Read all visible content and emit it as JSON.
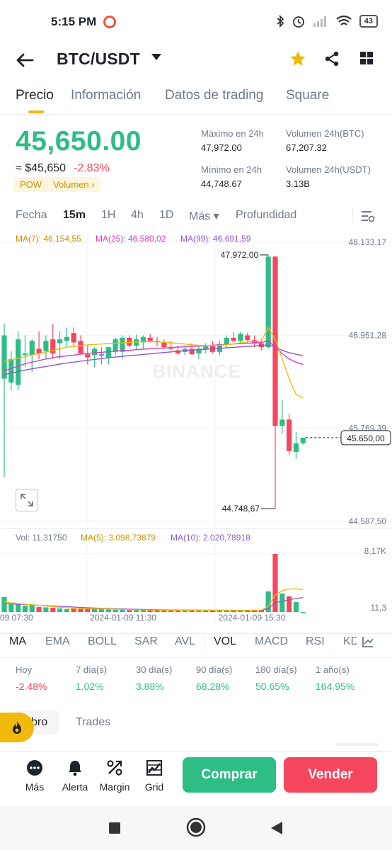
{
  "status_bar": {
    "time": "5:15 PM",
    "battery": "43"
  },
  "header": {
    "pair": "BTC/USDT"
  },
  "tabs": [
    {
      "label": "Precio"
    },
    {
      "label": "Información"
    },
    {
      "label": "Datos de trading"
    },
    {
      "label": "Square"
    }
  ],
  "ticker": {
    "price": "45,650.00",
    "usd_approx": "≈ $45,650",
    "change": "-2.83%",
    "tags": [
      "POW",
      "Volumen"
    ],
    "stats": [
      {
        "label": "Máximo en 24h",
        "value": "47,972.00"
      },
      {
        "label": "Volumen 24h(BTC)",
        "value": "67,207.32"
      },
      {
        "label": "Mínimo en 24h",
        "value": "44,748.67"
      },
      {
        "label": "Volumen 24h(USDT)",
        "value": "3.13B"
      }
    ]
  },
  "timeframes": [
    {
      "label": "Fecha"
    },
    {
      "label": "15m"
    },
    {
      "label": "1H"
    },
    {
      "label": "4h"
    },
    {
      "label": "1D"
    },
    {
      "label": "Más"
    },
    {
      "label": "Profundidad"
    }
  ],
  "ma_legend": {
    "ma7": "MA(7): 46.154,55",
    "ma25": "MA(25): 46.580,02",
    "ma99": "MA(99): 46.691,59"
  },
  "price_axis": [
    "48.133,17",
    "46.951,28",
    "45.769,39",
    "44.587,50"
  ],
  "chart_annotations": {
    "high": "47.972,00",
    "low": "44.748,67",
    "last": "45.650,00",
    "watermark": "BINANCE"
  },
  "volume_legend": {
    "vol": "Vol: 11,31750",
    "ma5": "MA(5): 3.098,73879",
    "ma10": "MA(10): 2.020,78918"
  },
  "volume_axis": [
    "8,17K",
    "11,3"
  ],
  "time_axis": [
    "09 07:30",
    "2024-01-09 11:30",
    "2024-01-09 15:30"
  ],
  "indicators": [
    {
      "label": "MA"
    },
    {
      "label": "EMA"
    },
    {
      "label": "BOLL"
    },
    {
      "label": "SAR"
    },
    {
      "label": "AVL"
    },
    {
      "label": "VOL"
    },
    {
      "label": "MACD"
    },
    {
      "label": "RSI"
    },
    {
      "label": "KD"
    }
  ],
  "performance": [
    {
      "label": "Hoy",
      "value": "-2.48%"
    },
    {
      "label": "7 día(s)",
      "value": "1.02%"
    },
    {
      "label": "30 día(s)",
      "value": "3.88%"
    },
    {
      "label": "90 día(s)",
      "value": "68.28%"
    },
    {
      "label": "180 día(s)",
      "value": "50.65%"
    },
    {
      "label": "1 año(s)",
      "value": "164.95%"
    }
  ],
  "book_tabs": [
    {
      "label": "bro"
    },
    {
      "label": "Trades"
    }
  ],
  "bottom_actions": [
    {
      "label": "Más"
    },
    {
      "label": "Alerta"
    },
    {
      "label": "Margin"
    },
    {
      "label": "Grid"
    }
  ],
  "buttons": {
    "buy": "Comprar",
    "sell": "Vender"
  },
  "colors": {
    "up": "#2ebd85",
    "down": "#f6465d",
    "accent": "#f0b90b",
    "ma7": "#f0b90b",
    "ma25": "#d63fbf",
    "ma99": "#8e59c7"
  },
  "candles": [
    {
      "o": 46400,
      "h": 47100,
      "l": 45150,
      "c": 46950
    },
    {
      "o": 46350,
      "h": 46750,
      "l": 46250,
      "c": 46650
    },
    {
      "o": 46320,
      "h": 47000,
      "l": 46250,
      "c": 46900
    },
    {
      "o": 46700,
      "h": 46950,
      "l": 46550,
      "c": 46720
    },
    {
      "o": 46700,
      "h": 46900,
      "l": 46480,
      "c": 46880
    },
    {
      "o": 46780,
      "h": 47000,
      "l": 46650,
      "c": 46720
    },
    {
      "o": 46750,
      "h": 46950,
      "l": 46650,
      "c": 46880
    },
    {
      "o": 46900,
      "h": 47100,
      "l": 46650,
      "c": 46720
    },
    {
      "o": 46850,
      "h": 47000,
      "l": 46650,
      "c": 46900
    },
    {
      "o": 46880,
      "h": 47050,
      "l": 46800,
      "c": 46930
    },
    {
      "o": 46980,
      "h": 47050,
      "l": 46800,
      "c": 46860
    },
    {
      "o": 46880,
      "h": 46950,
      "l": 46780,
      "c": 46720
    },
    {
      "o": 46710,
      "h": 46820,
      "l": 46580,
      "c": 46670
    },
    {
      "o": 46700,
      "h": 46800,
      "l": 46550,
      "c": 46780
    },
    {
      "o": 46690,
      "h": 46800,
      "l": 46580,
      "c": 46710
    },
    {
      "o": 46670,
      "h": 46800,
      "l": 46580,
      "c": 46800
    },
    {
      "o": 46740,
      "h": 46920,
      "l": 46700,
      "c": 46900
    },
    {
      "o": 46740,
      "h": 46950,
      "l": 46650,
      "c": 46920
    },
    {
      "o": 46920,
      "h": 46950,
      "l": 46800,
      "c": 46820
    },
    {
      "o": 46820,
      "h": 46960,
      "l": 46760,
      "c": 46900
    },
    {
      "o": 46860,
      "h": 46950,
      "l": 46780,
      "c": 46930
    },
    {
      "o": 46920,
      "h": 46970,
      "l": 46860,
      "c": 46880
    },
    {
      "o": 46880,
      "h": 46930,
      "l": 46810,
      "c": 46870
    },
    {
      "o": 46860,
      "h": 46900,
      "l": 46780,
      "c": 46800
    },
    {
      "o": 46800,
      "h": 46880,
      "l": 46760,
      "c": 46780
    },
    {
      "o": 46760,
      "h": 46820,
      "l": 46700,
      "c": 46720
    },
    {
      "o": 46740,
      "h": 46820,
      "l": 46700,
      "c": 46780
    },
    {
      "o": 46780,
      "h": 46850,
      "l": 46700,
      "c": 46710
    },
    {
      "o": 46720,
      "h": 46820,
      "l": 46650,
      "c": 46780
    },
    {
      "o": 46780,
      "h": 46850,
      "l": 46720,
      "c": 46810
    },
    {
      "o": 46820,
      "h": 46880,
      "l": 46720,
      "c": 46740
    },
    {
      "o": 46740,
      "h": 46880,
      "l": 46700,
      "c": 46840
    },
    {
      "o": 46840,
      "h": 46950,
      "l": 46800,
      "c": 46920
    },
    {
      "o": 46920,
      "h": 46990,
      "l": 46860,
      "c": 46880
    },
    {
      "o": 46880,
      "h": 46990,
      "l": 46840,
      "c": 46970
    },
    {
      "o": 46950,
      "h": 46980,
      "l": 46860,
      "c": 46890
    },
    {
      "o": 46890,
      "h": 46950,
      "l": 46800,
      "c": 46850
    },
    {
      "o": 46850,
      "h": 46900,
      "l": 46760,
      "c": 46800
    },
    {
      "o": 46800,
      "h": 47972,
      "l": 46780,
      "c": 47950
    },
    {
      "o": 47950,
      "h": 47960,
      "l": 44748,
      "c": 45800
    },
    {
      "o": 45800,
      "h": 46130,
      "l": 45700,
      "c": 45880
    },
    {
      "o": 45880,
      "h": 45950,
      "l": 45430,
      "c": 45480
    },
    {
      "o": 45470,
      "h": 45720,
      "l": 45380,
      "c": 45580
    },
    {
      "o": 45580,
      "h": 45650,
      "l": 45560,
      "c": 45650
    }
  ],
  "volumes": [
    2100,
    1100,
    1200,
    900,
    1000,
    700,
    650,
    600,
    500,
    400,
    450,
    500,
    520,
    420,
    380,
    350,
    320,
    300,
    280,
    300,
    260,
    250,
    240,
    230,
    260,
    280,
    250,
    230,
    220,
    240,
    260,
    230,
    250,
    240,
    230,
    250,
    260,
    300,
    2900,
    8170,
    2600,
    2200,
    1400,
    11.3
  ],
  "ma7": [
    46620,
    46640,
    46660,
    46680,
    46700,
    46720,
    46740,
    46760,
    46780,
    46800,
    46810,
    46820,
    46830,
    46835,
    46840,
    46845,
    46850,
    46855,
    46860,
    46865,
    46870,
    46870,
    46868,
    46862,
    46855,
    46848,
    46840,
    46830,
    46825,
    46822,
    46822,
    46825,
    46830,
    46840,
    46855,
    46868,
    46875,
    46880,
    47050,
    46900,
    46650,
    46400,
    46200,
    46154
  ],
  "ma25": [
    46500,
    46530,
    46560,
    46590,
    46610,
    46630,
    46650,
    46665,
    46680,
    46690,
    46700,
    46710,
    46720,
    46728,
    46735,
    46742,
    46750,
    46756,
    46762,
    46768,
    46774,
    46780,
    46785,
    46790,
    46795,
    46800,
    46805,
    46810,
    46815,
    46820,
    46825,
    46830,
    46835,
    46840,
    46845,
    46850,
    46855,
    46860,
    46880,
    46800,
    46720,
    46650,
    46610,
    46580
  ],
  "ma99": [
    46450,
    46470,
    46490,
    46510,
    46525,
    46540,
    46555,
    46570,
    46585,
    46598,
    46610,
    46622,
    46634,
    46645,
    46655,
    46665,
    46675,
    46684,
    46692,
    46700,
    46708,
    46716,
    46724,
    46732,
    46740,
    46748,
    46755,
    46762,
    46768,
    46774,
    46780,
    46786,
    46792,
    46798,
    46804,
    46810,
    46815,
    46820,
    46830,
    46800,
    46760,
    46730,
    46710,
    46691
  ],
  "vol_ma5": [
    1400,
    1300,
    1200,
    1100,
    1020,
    950,
    850,
    760,
    670,
    580,
    520,
    500,
    480,
    470,
    450,
    430,
    400,
    360,
    330,
    310,
    295,
    280,
    270,
    260,
    255,
    255,
    252,
    250,
    248,
    248,
    245,
    245,
    245,
    245,
    245,
    245,
    245,
    250,
    800,
    2400,
    3000,
    3200,
    3300,
    3098
  ],
  "vol_ma10": [
    1200,
    1150,
    1100,
    1050,
    1000,
    950,
    900,
    850,
    800,
    750,
    700,
    650,
    600,
    560,
    520,
    490,
    460,
    430,
    400,
    380,
    360,
    340,
    320,
    300,
    290,
    280,
    270,
    260,
    255,
    250,
    248,
    246,
    245,
    244,
    243,
    242,
    242,
    244,
    500,
    1300,
    1500,
    1700,
    1900,
    2020
  ]
}
